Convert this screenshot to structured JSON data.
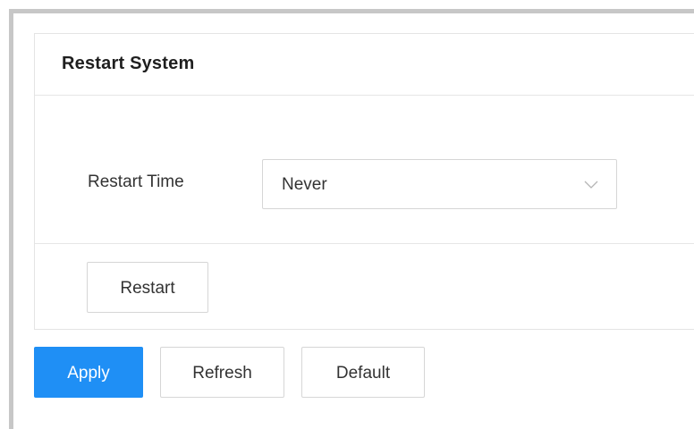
{
  "panel": {
    "title": "Restart System",
    "restart_time": {
      "label": "Restart Time",
      "selected_value": "Never",
      "icon": "chevron-down-icon"
    },
    "restart_button_label": "Restart"
  },
  "footer": {
    "apply_label": "Apply",
    "refresh_label": "Refresh",
    "default_label": "Default"
  },
  "colors": {
    "accent": "#1f8ff5",
    "border": "#d6d6d6",
    "text": "#333333"
  }
}
